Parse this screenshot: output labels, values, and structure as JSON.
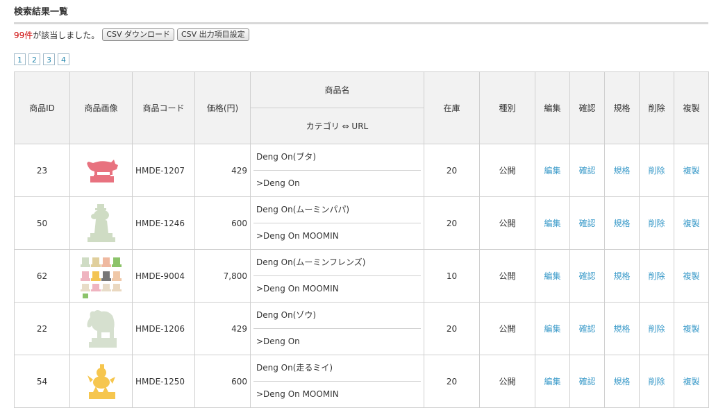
{
  "page": {
    "title": "検索結果一覧",
    "result_count": "99件",
    "result_suffix": "が該当しました。",
    "csv_download": "CSV ダウンロード",
    "csv_settings": "CSV 出力項目設定"
  },
  "pager": [
    "1",
    "2",
    "3",
    "4"
  ],
  "columns": {
    "id": "商品ID",
    "image": "商品画像",
    "code": "商品コード",
    "price": "価格(円)",
    "name": "商品名",
    "category_url": "カテゴリ ⇔ URL",
    "stock": "在庫",
    "type": "種別",
    "edit": "編集",
    "confirm": "確認",
    "spec": "規格",
    "delete": "削除",
    "copy": "複製"
  },
  "colors": {
    "count": "#cc0000",
    "link": "#3a9ac9",
    "header_bg": "#f2f2f2"
  },
  "products": [
    {
      "id": "23",
      "image": "pig-figure-icon",
      "code": "HMDE-1207",
      "price": "429",
      "name": "Deng On(ブタ)",
      "category": ">Deng On",
      "stock": "20",
      "type": "公開",
      "edit": "編集",
      "confirm": "確認",
      "spec": "規格",
      "delete": "削除",
      "copy": "複製"
    },
    {
      "id": "50",
      "image": "moominpapa-figure-icon",
      "code": "HMDE-1246",
      "price": "600",
      "name": "Deng On(ムーミンパパ)",
      "category": ">Deng On MOOMIN",
      "stock": "20",
      "type": "公開",
      "edit": "編集",
      "confirm": "確認",
      "spec": "規格",
      "delete": "削除",
      "copy": "複製"
    },
    {
      "id": "62",
      "image": "moomin-friends-set-icon",
      "code": "HMDE-9004",
      "price": "7,800",
      "name": "Deng On(ムーミンフレンズ)",
      "category": ">Deng On MOOMIN",
      "stock": "10",
      "type": "公開",
      "edit": "編集",
      "confirm": "確認",
      "spec": "規格",
      "delete": "削除",
      "copy": "複製"
    },
    {
      "id": "22",
      "image": "elephant-figure-icon",
      "code": "HMDE-1206",
      "price": "429",
      "name": "Deng On(ゾウ)",
      "category": ">Deng On",
      "stock": "20",
      "type": "公開",
      "edit": "編集",
      "confirm": "確認",
      "spec": "規格",
      "delete": "削除",
      "copy": "複製"
    },
    {
      "id": "54",
      "image": "running-mii-figure-icon",
      "code": "HMDE-1250",
      "price": "600",
      "name": "Deng On(走るミイ)",
      "category": ">Deng On MOOMIN",
      "stock": "20",
      "type": "公開",
      "edit": "編集",
      "confirm": "確認",
      "spec": "規格",
      "delete": "削除",
      "copy": "複製"
    }
  ]
}
